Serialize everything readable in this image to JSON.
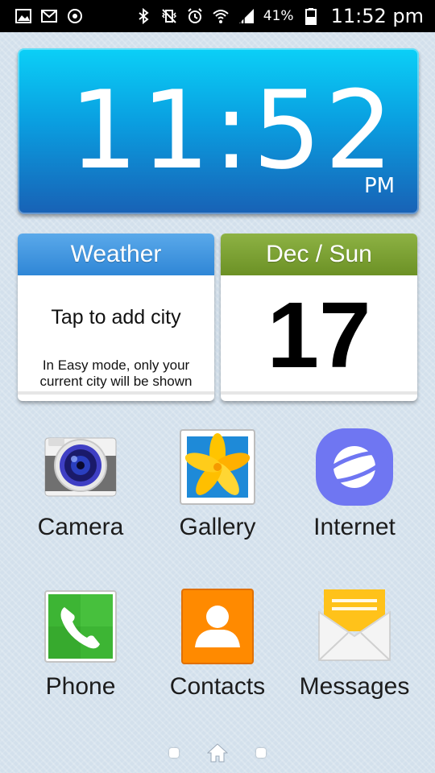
{
  "status_bar": {
    "left_icons": [
      "gallery-icon",
      "gmail-icon",
      "sync-icon"
    ],
    "right_icons": [
      "bluetooth-icon",
      "vibrate-mute-icon",
      "alarm-icon",
      "wifi-icon",
      "signal-icon",
      "battery-icon"
    ],
    "battery_percent": "41%",
    "time": "11:52 pm"
  },
  "clock_widget": {
    "time": "11:52",
    "ampm": "PM"
  },
  "weather_card": {
    "title": "Weather",
    "main_text": "Tap to add city",
    "note_line1": "In Easy mode, only your",
    "note_line2": "current city will be shown"
  },
  "date_card": {
    "title": "Dec / Sun",
    "day": "17"
  },
  "apps": [
    {
      "label": "Camera",
      "icon": "camera-icon"
    },
    {
      "label": "Gallery",
      "icon": "gallery-icon"
    },
    {
      "label": "Internet",
      "icon": "internet-icon"
    },
    {
      "label": "Phone",
      "icon": "phone-icon"
    },
    {
      "label": "Contacts",
      "icon": "contacts-icon"
    },
    {
      "label": "Messages",
      "icon": "messages-icon"
    }
  ],
  "pager": {
    "pages": 3,
    "current": 2
  },
  "colors": {
    "clock_top": "#0bd0f7",
    "clock_bottom": "#1861b5",
    "weather_header": "#2f86d6",
    "date_header": "#6c9125",
    "background": "#d3e0ec"
  }
}
